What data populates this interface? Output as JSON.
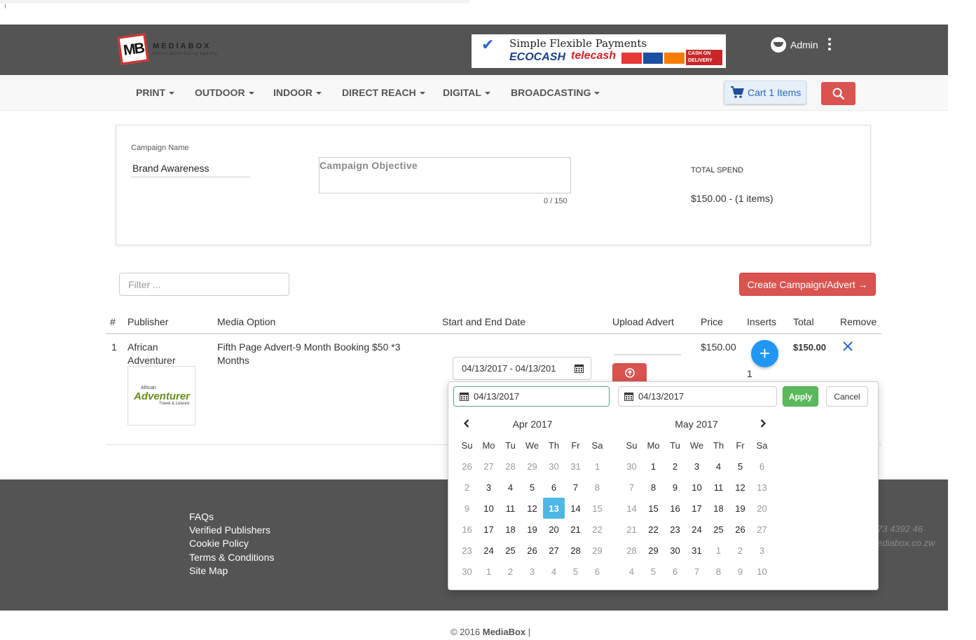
{
  "brand": {
    "logo_mark": "MB",
    "logo_name": "MEDIABOX",
    "logo_tagline": "online advertising agency"
  },
  "banner": {
    "title": "Simple Flexible Payments",
    "ecocash": "ECOCASH",
    "telecash": "telecash",
    "cod": "CASH ON DELIVERY"
  },
  "user": {
    "name": "Admin"
  },
  "nav": {
    "items": [
      "PRINT",
      "OUTDOOR",
      "INDOOR",
      "DIRECT REACH",
      "DIGITAL",
      "BROADCASTING"
    ],
    "cart_label": "Cart 1 Items"
  },
  "campaign": {
    "name_label": "Campaign Name",
    "name_value": "Brand Awareness",
    "objective_placeholder": "Campaign Objective",
    "objective_counter": "0 / 150",
    "total_spend_label": "TOTAL SPEND",
    "total_spend_value": "$150.00 - (1 items)"
  },
  "filter": {
    "placeholder": "Filter ..."
  },
  "create_button": "Create Campaign/Advert →",
  "table": {
    "headers": [
      "#",
      "Publisher",
      "Media Option",
      "Start and End Date",
      "Upload Advert",
      "Price",
      "Inserts",
      "Total",
      "Remove"
    ],
    "rows": [
      {
        "index": "1",
        "publisher_line1": "African",
        "publisher_line2": "Adventurer",
        "publisher_logo_top": "African",
        "publisher_logo_main": "Adventurer",
        "publisher_logo_sub": "Travel & Leisure",
        "media_line1": "Fifth Page Advert-9 Month Booking $50 *3",
        "media_line2": "Months",
        "date_range": "04/13/2017 - 04/13/201",
        "price": "$150.00",
        "inserts": "1",
        "total": "$150.00"
      }
    ]
  },
  "footer": {
    "links": [
      "FAQs",
      "Verified Publishers",
      "Cookie Policy",
      "Terms & Conditions",
      "Site Map"
    ],
    "phone_partial": "73 4392 46",
    "email_partial": "ediabox.co.zw",
    "copyright_prefix": "© 2016 ",
    "copyright_brand": "MediaBox",
    "copyright_suffix": " |"
  },
  "datepicker": {
    "start_value": "04/13/2017",
    "end_value": "04/13/2017",
    "apply_label": "Apply",
    "cancel_label": "Cancel",
    "weekdays": [
      "Su",
      "Mo",
      "Tu",
      "We",
      "Th",
      "Fr",
      "Sa"
    ],
    "left_month": {
      "title": "Apr 2017",
      "weeks": [
        [
          [
            "26",
            "off"
          ],
          [
            "27",
            "off"
          ],
          [
            "28",
            "off"
          ],
          [
            "29",
            "off"
          ],
          [
            "30",
            "off"
          ],
          [
            "31",
            "off"
          ],
          [
            "1",
            "off"
          ]
        ],
        [
          [
            "2",
            "off"
          ],
          [
            "3",
            ""
          ],
          [
            "4",
            ""
          ],
          [
            "5",
            ""
          ],
          [
            "6",
            ""
          ],
          [
            "7",
            ""
          ],
          [
            "8",
            "off"
          ]
        ],
        [
          [
            "9",
            "off"
          ],
          [
            "10",
            ""
          ],
          [
            "11",
            ""
          ],
          [
            "12",
            ""
          ],
          [
            "13",
            "active"
          ],
          [
            "14",
            ""
          ],
          [
            "15",
            "off"
          ]
        ],
        [
          [
            "16",
            "off"
          ],
          [
            "17",
            ""
          ],
          [
            "18",
            ""
          ],
          [
            "19",
            ""
          ],
          [
            "20",
            ""
          ],
          [
            "21",
            ""
          ],
          [
            "22",
            "off"
          ]
        ],
        [
          [
            "23",
            "off"
          ],
          [
            "24",
            ""
          ],
          [
            "25",
            ""
          ],
          [
            "26",
            ""
          ],
          [
            "27",
            ""
          ],
          [
            "28",
            ""
          ],
          [
            "29",
            "off"
          ]
        ],
        [
          [
            "30",
            "off"
          ],
          [
            "1",
            "off"
          ],
          [
            "2",
            "off"
          ],
          [
            "3",
            "off"
          ],
          [
            "4",
            "off"
          ],
          [
            "5",
            "off"
          ],
          [
            "6",
            "off"
          ]
        ]
      ]
    },
    "right_month": {
      "title": "May 2017",
      "weeks": [
        [
          [
            "30",
            "off"
          ],
          [
            "1",
            ""
          ],
          [
            "2",
            ""
          ],
          [
            "3",
            ""
          ],
          [
            "4",
            ""
          ],
          [
            "5",
            ""
          ],
          [
            "6",
            "off"
          ]
        ],
        [
          [
            "7",
            "off"
          ],
          [
            "8",
            ""
          ],
          [
            "9",
            ""
          ],
          [
            "10",
            ""
          ],
          [
            "11",
            ""
          ],
          [
            "12",
            ""
          ],
          [
            "13",
            "off"
          ]
        ],
        [
          [
            "14",
            "off"
          ],
          [
            "15",
            ""
          ],
          [
            "16",
            ""
          ],
          [
            "17",
            ""
          ],
          [
            "18",
            ""
          ],
          [
            "19",
            ""
          ],
          [
            "20",
            "off"
          ]
        ],
        [
          [
            "21",
            "off"
          ],
          [
            "22",
            ""
          ],
          [
            "23",
            ""
          ],
          [
            "24",
            ""
          ],
          [
            "25",
            ""
          ],
          [
            "26",
            ""
          ],
          [
            "27",
            "off"
          ]
        ],
        [
          [
            "28",
            "off"
          ],
          [
            "29",
            ""
          ],
          [
            "30",
            ""
          ],
          [
            "31",
            ""
          ],
          [
            "1",
            "off"
          ],
          [
            "2",
            "off"
          ],
          [
            "3",
            "off"
          ]
        ],
        [
          [
            "4",
            "off"
          ],
          [
            "5",
            "off"
          ],
          [
            "6",
            "off"
          ],
          [
            "7",
            "off"
          ],
          [
            "8",
            "off"
          ],
          [
            "9",
            "off"
          ],
          [
            "10",
            "off"
          ]
        ]
      ]
    }
  },
  "colors": {
    "header_bg": "#545454",
    "danger": "#d9534f",
    "success": "#5cb85c",
    "primary": "#2196f3",
    "active_day": "#4fb7e6"
  }
}
